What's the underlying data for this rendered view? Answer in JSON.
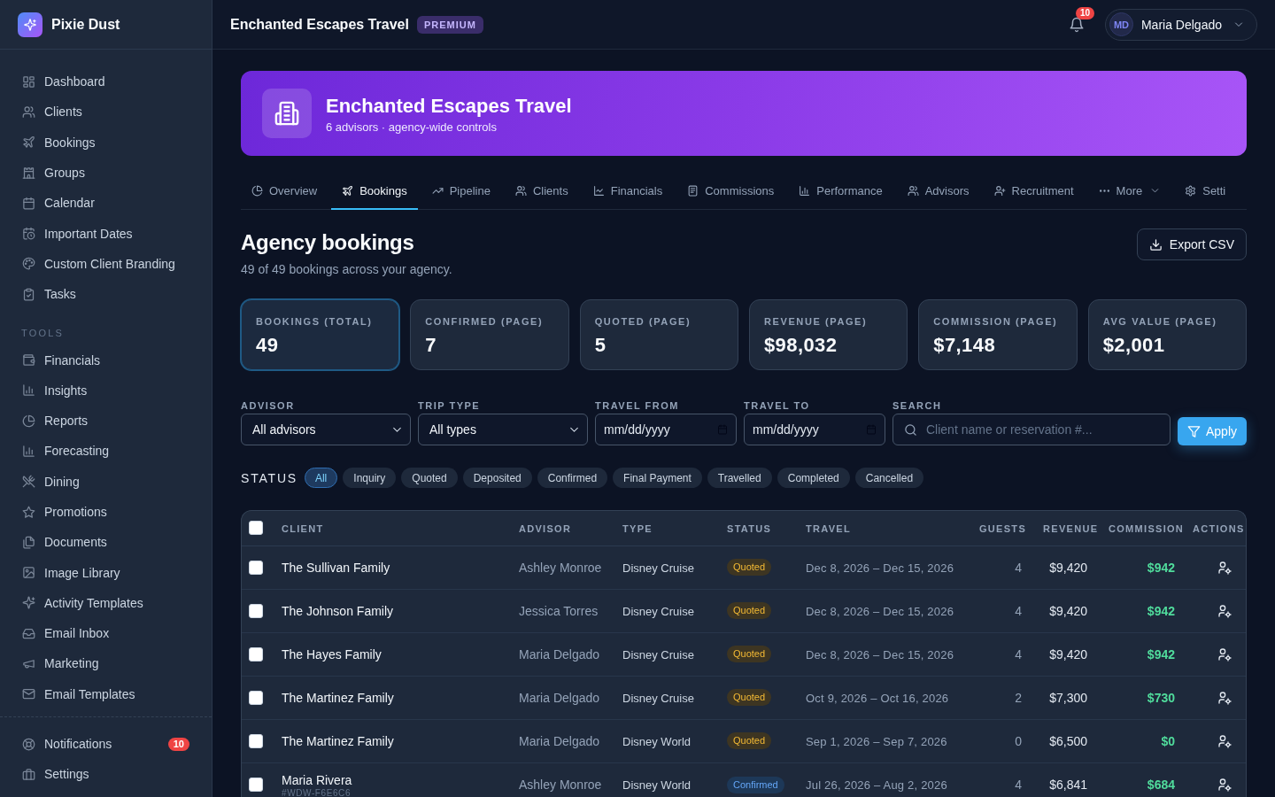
{
  "sidebar": {
    "brand": "Pixie Dust",
    "main_items": [
      {
        "label": "Dashboard",
        "selected": false
      },
      {
        "label": "Clients",
        "selected": false
      },
      {
        "label": "Bookings",
        "selected": false
      },
      {
        "label": "Groups",
        "selected": false
      },
      {
        "label": "Calendar",
        "selected": false
      },
      {
        "label": "Important Dates",
        "selected": false
      },
      {
        "label": "Custom Client Branding",
        "selected": false
      },
      {
        "label": "Tasks",
        "selected": false
      }
    ],
    "tools": {
      "heading": "TOOLS",
      "items": [
        {
          "label": "Financials",
          "selected": false
        },
        {
          "label": "Insights",
          "selected": false
        },
        {
          "label": "Reports",
          "selected": false
        },
        {
          "label": "Forecasting",
          "selected": false
        },
        {
          "label": "Dining",
          "selected": false
        },
        {
          "label": "Promotions",
          "selected": false
        },
        {
          "label": "Documents",
          "selected": false
        },
        {
          "label": "Image Library",
          "selected": false
        },
        {
          "label": "Activity Templates",
          "selected": false
        },
        {
          "label": "Email Inbox",
          "selected": false
        },
        {
          "label": "Marketing",
          "selected": false
        },
        {
          "label": "Email Templates",
          "selected": false
        }
      ]
    },
    "footer_items": [
      {
        "label": "Notifications",
        "badge": "10",
        "selected": false
      },
      {
        "label": "Settings",
        "selected": false
      }
    ]
  },
  "topbar": {
    "title": "Enchanted Escapes Travel",
    "badge": "PREMIUM",
    "notifications": "10",
    "user": {
      "initials": "MD",
      "name": "Maria Delgado"
    }
  },
  "banner": {
    "title": "Enchanted Escapes Travel",
    "subtitle": "6 advisors · agency-wide controls"
  },
  "tabs": [
    {
      "label": "Overview",
      "kind": "link",
      "selected": false
    },
    {
      "label": "Bookings",
      "kind": "link",
      "selected": true
    },
    {
      "label": "Pipeline",
      "kind": "link",
      "selected": false
    },
    {
      "label": "Clients",
      "kind": "link",
      "selected": false
    },
    {
      "label": "Financials",
      "kind": "link",
      "selected": false
    },
    {
      "label": "Commissions",
      "kind": "link",
      "selected": false
    },
    {
      "label": "Performance",
      "kind": "link",
      "selected": false
    },
    {
      "label": "Advisors",
      "kind": "link",
      "selected": false
    },
    {
      "label": "Recruitment",
      "kind": "link",
      "selected": false
    },
    {
      "label": "More",
      "kind": "menu",
      "selected": false
    },
    {
      "label": "Setti",
      "kind": "link",
      "selected": false
    }
  ],
  "page": {
    "title": "Agency bookings",
    "subtitle": "49 of 49 bookings across your agency.",
    "export_button": "Export CSV"
  },
  "stats": [
    {
      "label": "BOOKINGS (TOTAL)",
      "value": "49",
      "selected": true
    },
    {
      "label": "CONFIRMED (PAGE)",
      "value": "7",
      "selected": false
    },
    {
      "label": "QUOTED (PAGE)",
      "value": "5",
      "selected": false
    },
    {
      "label": "REVENUE (PAGE)",
      "value": "$98,032",
      "selected": false
    },
    {
      "label": "COMMISSION (PAGE)",
      "value": "$7,148",
      "selected": false
    },
    {
      "label": "AVG VALUE (PAGE)",
      "value": "$2,001",
      "selected": false
    }
  ],
  "filters": {
    "fields": [
      {
        "kind": "select",
        "label": "ADVISOR",
        "value": "All advisors"
      },
      {
        "kind": "select",
        "label": "TRIP TYPE",
        "value": "All types"
      },
      {
        "kind": "date",
        "label": "TRAVEL FROM",
        "placeholder": "mm/dd/yyyy"
      },
      {
        "kind": "date",
        "label": "TRAVEL TO",
        "placeholder": "mm/dd/yyyy"
      },
      {
        "kind": "search",
        "label": "SEARCH",
        "placeholder": "Client name or reservation #..."
      }
    ],
    "apply_button": "Apply"
  },
  "status_filter": {
    "label": "STATUS",
    "options": [
      {
        "label": "All",
        "selected": true
      },
      {
        "label": "Inquiry",
        "selected": false
      },
      {
        "label": "Quoted",
        "selected": false
      },
      {
        "label": "Deposited",
        "selected": false
      },
      {
        "label": "Confirmed",
        "selected": false
      },
      {
        "label": "Final Payment",
        "selected": false
      },
      {
        "label": "Travelled",
        "selected": false
      },
      {
        "label": "Completed",
        "selected": false
      },
      {
        "label": "Cancelled",
        "selected": false
      }
    ]
  },
  "table": {
    "select_all": {
      "checked": false
    },
    "columns": [
      "CLIENT",
      "ADVISOR",
      "TYPE",
      "STATUS",
      "TRAVEL",
      "GUESTS",
      "REVENUE",
      "COMMISSION",
      "ACTIONS"
    ],
    "rows": [
      {
        "checked": false,
        "client": "The Sullivan Family",
        "advisor": "Ashley Monroe",
        "type": "Disney Cruise",
        "status": {
          "label": "Quoted",
          "color": "#3d3522"
        },
        "travel": "Dec 8, 2026 – Dec 15, 2026",
        "guests": "4",
        "revenue": "$9,420",
        "commission": "$942"
      },
      {
        "checked": false,
        "client": "The Johnson Family",
        "advisor": "Jessica Torres",
        "type": "Disney Cruise",
        "status": {
          "label": "Quoted",
          "color": "#3d3522"
        },
        "travel": "Dec 8, 2026 – Dec 15, 2026",
        "guests": "4",
        "revenue": "$9,420",
        "commission": "$942"
      },
      {
        "checked": false,
        "client": "The Hayes Family",
        "advisor": "Maria Delgado",
        "type": "Disney Cruise",
        "status": {
          "label": "Quoted",
          "color": "#3d3522"
        },
        "travel": "Dec 8, 2026 – Dec 15, 2026",
        "guests": "4",
        "revenue": "$9,420",
        "commission": "$942"
      },
      {
        "checked": false,
        "client": "The Martinez Family",
        "advisor": "Maria Delgado",
        "type": "Disney Cruise",
        "status": {
          "label": "Quoted",
          "color": "#3d3522"
        },
        "travel": "Oct 9, 2026 – Oct 16, 2026",
        "guests": "2",
        "revenue": "$7,300",
        "commission": "$730"
      },
      {
        "checked": false,
        "client": "The Martinez Family",
        "advisor": "Maria Delgado",
        "type": "Disney World",
        "status": {
          "label": "Quoted",
          "color": "#3d3522"
        },
        "travel": "Sep 1, 2026 – Sep 7, 2026",
        "guests": "0",
        "revenue": "$6,500",
        "commission": "$0"
      },
      {
        "checked": false,
        "client": "Maria Rivera",
        "reference": "#WDW-F6E6C6",
        "advisor": "Ashley Monroe",
        "type": "Disney World",
        "status": {
          "label": "Confirmed",
          "color": "#1d3858"
        },
        "travel": "Jul 26, 2026 – Aug 2, 2026",
        "guests": "4",
        "revenue": "$6,841",
        "commission": "$684"
      }
    ]
  }
}
